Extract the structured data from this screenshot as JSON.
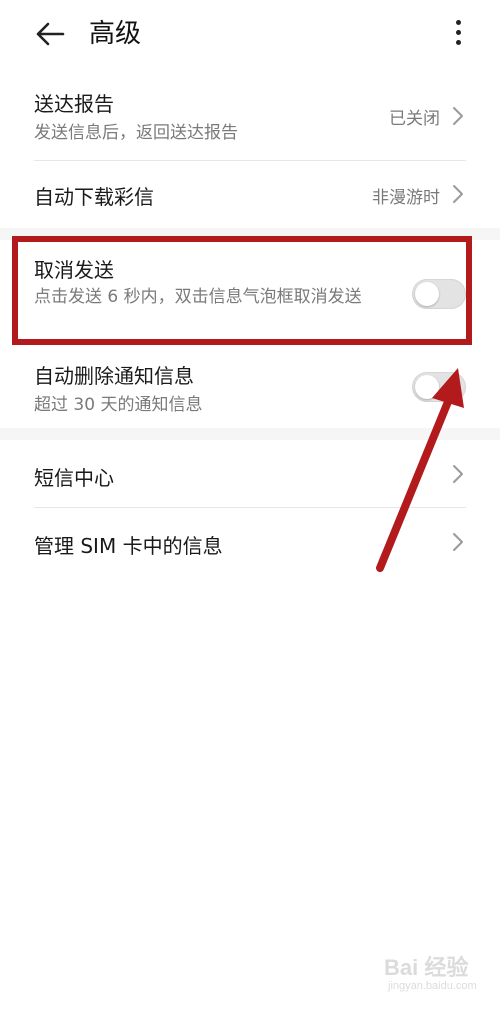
{
  "header": {
    "title": "高级"
  },
  "settings": {
    "delivery_report": {
      "title": "送达报告",
      "subtitle": "发送信息后，返回送达报告",
      "value": "已关闭"
    },
    "auto_download_mms": {
      "title": "自动下载彩信",
      "value": "非漫游时"
    },
    "cancel_send": {
      "title": "取消发送",
      "subtitle": "点击发送 6 秒内，双击信息气泡框取消发送",
      "enabled": false
    },
    "auto_delete_notifications": {
      "title": "自动删除通知信息",
      "subtitle": "超过 30 天的通知信息",
      "enabled": false
    },
    "sms_center": {
      "title": "短信中心"
    },
    "manage_sim_messages": {
      "title": "管理 SIM 卡中的信息"
    }
  },
  "annotation": {
    "color": "#b31a1c"
  },
  "watermark": {
    "brand": "Bai 经验",
    "url": "jingyan.baidu.com"
  }
}
